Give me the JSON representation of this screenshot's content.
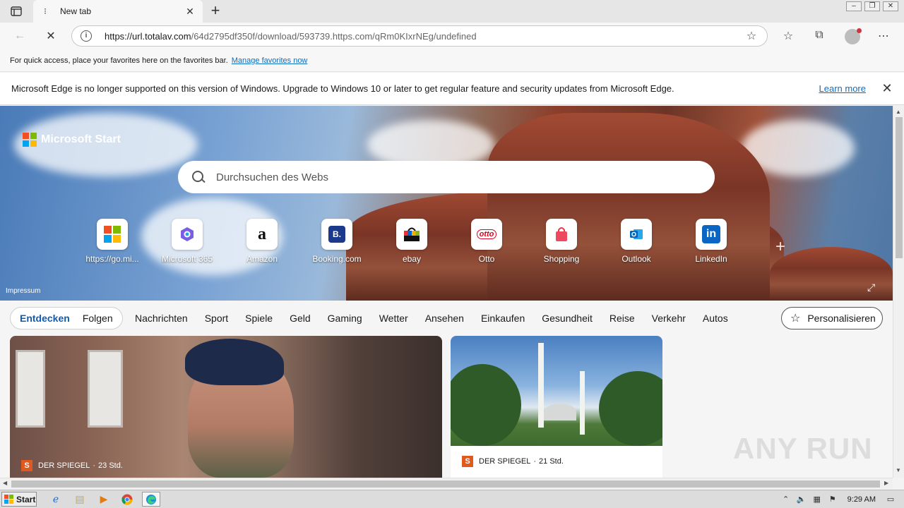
{
  "browser": {
    "tab": {
      "title": "New tab"
    },
    "address": {
      "url_host": "https://url.totalav.com",
      "url_rest": "/64d2795df350f/download/593739.https.com/qRm0KIxrNEg/undefined"
    },
    "favorites_bar": {
      "text": "For quick access, place your favorites here on the favorites bar.",
      "link": "Manage favorites now"
    },
    "info_bar": {
      "message": "Microsoft Edge is no longer supported on this version of Windows. Upgrade to Windows 10 or later to get regular feature and security updates from Microsoft Edge.",
      "link": "Learn more"
    }
  },
  "start_page": {
    "brand": "Microsoft Start",
    "search": {
      "placeholder": "Durchsuchen des Webs"
    },
    "tiles": [
      {
        "label": "https://go.mi...",
        "icon": "windows-icon"
      },
      {
        "label": "Microsoft 365",
        "icon": "m365-icon"
      },
      {
        "label": "Amazon",
        "icon": "amazon-icon",
        "glyph": "a"
      },
      {
        "label": "Booking.com",
        "icon": "booking-icon",
        "glyph": "B."
      },
      {
        "label": "ebay",
        "icon": "ebay-icon"
      },
      {
        "label": "Otto",
        "icon": "otto-icon",
        "glyph": "otto"
      },
      {
        "label": "Shopping",
        "icon": "shopping-bag-icon"
      },
      {
        "label": "Outlook",
        "icon": "outlook-icon"
      },
      {
        "label": "LinkedIn",
        "icon": "linkedin-icon",
        "glyph": "in"
      }
    ],
    "impressum": "Impressum",
    "tabs": [
      "Entdecken",
      "Folgen"
    ],
    "categories": [
      "Nachrichten",
      "Sport",
      "Spiele",
      "Geld",
      "Gaming",
      "Wetter",
      "Ansehen",
      "Einkaufen",
      "Gesundheit",
      "Reise",
      "Verkehr",
      "Autos"
    ],
    "personalize": "Personalisieren",
    "cards": [
      {
        "source": "DER SPIEGEL",
        "age": "23 Std.",
        "logo": "S"
      },
      {
        "source": "DER SPIEGEL",
        "age": "21 Std.",
        "logo": "S"
      }
    ]
  },
  "watermark": "ANY RUN",
  "taskbar": {
    "start": "Start",
    "clock": "9:29 AM"
  },
  "colors": {
    "accent": "#0f6cbd",
    "spiegel": "#e05a1f"
  }
}
